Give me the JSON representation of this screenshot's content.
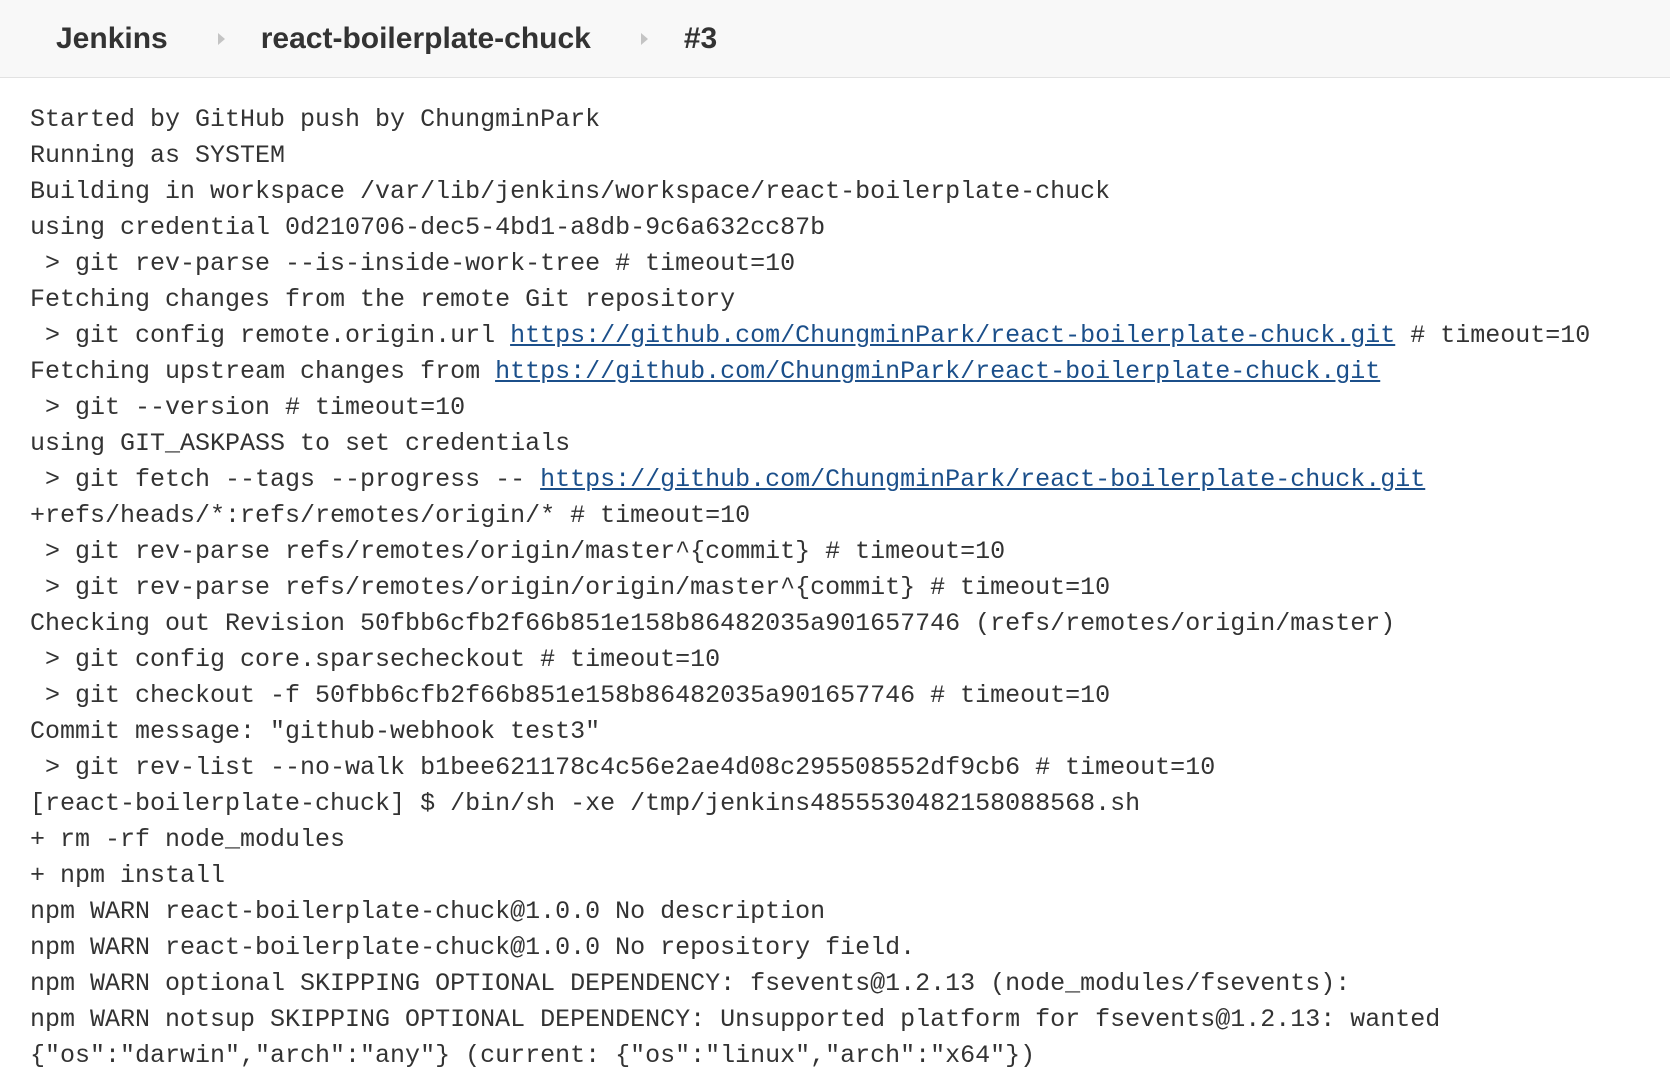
{
  "breadcrumb": {
    "jenkins_label": "Jenkins",
    "job_label": "react-boilerplate-chuck",
    "build_label": "#3",
    "separator_icon": "chevron-right-icon"
  },
  "console": {
    "lines": [
      [
        {
          "text": "Started by GitHub push by ChungminPark"
        }
      ],
      [
        {
          "text": "Running as SYSTEM"
        }
      ],
      [
        {
          "text": "Building in workspace /var/lib/jenkins/workspace/react-boilerplate-chuck"
        }
      ],
      [
        {
          "text": "using credential 0d210706-dec5-4bd1-a8db-9c6a632cc87b"
        }
      ],
      [
        {
          "text": " > git rev-parse --is-inside-work-tree # timeout=10"
        }
      ],
      [
        {
          "text": "Fetching changes from the remote Git repository"
        }
      ],
      [
        {
          "text": " > git config remote.origin.url "
        },
        {
          "text": "https://github.com/ChungminPark/react-boilerplate-chuck.git",
          "link": true
        },
        {
          "text": " # timeout=10"
        }
      ],
      [
        {
          "text": "Fetching upstream changes from "
        },
        {
          "text": "https://github.com/ChungminPark/react-boilerplate-chuck.git",
          "link": true
        }
      ],
      [
        {
          "text": " > git --version # timeout=10"
        }
      ],
      [
        {
          "text": "using GIT_ASKPASS to set credentials"
        }
      ],
      [
        {
          "text": " > git fetch --tags --progress -- "
        },
        {
          "text": "https://github.com/ChungminPark/react-boilerplate-chuck.git",
          "link": true
        }
      ],
      [
        {
          "text": "+refs/heads/*:refs/remotes/origin/* # timeout=10"
        }
      ],
      [
        {
          "text": " > git rev-parse refs/remotes/origin/master^{commit} # timeout=10"
        }
      ],
      [
        {
          "text": " > git rev-parse refs/remotes/origin/origin/master^{commit} # timeout=10"
        }
      ],
      [
        {
          "text": "Checking out Revision 50fbb6cfb2f66b851e158b86482035a901657746 (refs/remotes/origin/master)"
        }
      ],
      [
        {
          "text": " > git config core.sparsecheckout # timeout=10"
        }
      ],
      [
        {
          "text": " > git checkout -f 50fbb6cfb2f66b851e158b86482035a901657746 # timeout=10"
        }
      ],
      [
        {
          "text": "Commit message: \"github-webhook test3\""
        }
      ],
      [
        {
          "text": " > git rev-list --no-walk b1bee621178c4c56e2ae4d08c295508552df9cb6 # timeout=10"
        }
      ],
      [
        {
          "text": "[react-boilerplate-chuck] $ /bin/sh -xe /tmp/jenkins4855530482158088568.sh"
        }
      ],
      [
        {
          "text": "+ rm -rf node_modules"
        }
      ],
      [
        {
          "text": "+ npm install"
        }
      ],
      [
        {
          "text": "npm WARN react-boilerplate-chuck@1.0.0 No description"
        }
      ],
      [
        {
          "text": "npm WARN react-boilerplate-chuck@1.0.0 No repository field."
        }
      ],
      [
        {
          "text": "npm WARN optional SKIPPING OPTIONAL DEPENDENCY: fsevents@1.2.13 (node_modules/fsevents):"
        }
      ],
      [
        {
          "text": "npm WARN notsup SKIPPING OPTIONAL DEPENDENCY: Unsupported platform for fsevents@1.2.13: wanted"
        }
      ],
      [
        {
          "text": "{\"os\":\"darwin\",\"arch\":\"any\"} (current: {\"os\":\"linux\",\"arch\":\"x64\"})"
        }
      ]
    ]
  },
  "colors": {
    "breadcrumb_bg": "#f8f8f8",
    "text": "#333333",
    "link": "#1b4f8a",
    "separator": "#c4c4c4"
  }
}
